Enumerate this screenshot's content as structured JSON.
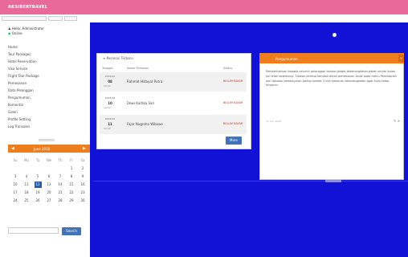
{
  "app": {
    "title": "AKSIBERTRAVEL"
  },
  "filters": [
    {
      "value": ""
    },
    {
      "value": ""
    },
    {
      "value": ""
    }
  ],
  "sidebar": {
    "user_name": "Hello, Administrator",
    "user_role": "Online",
    "items": [
      {
        "label": "Home"
      },
      {
        "label": "Tour Packages"
      },
      {
        "label": "Hotel Reservation"
      },
      {
        "label": "Visa Service"
      },
      {
        "label": "Flight Tour Package"
      },
      {
        "label": "Pemesanan"
      },
      {
        "label": "Data Pelanggan"
      },
      {
        "label": "Pengumuman"
      },
      {
        "label": "Komentar"
      },
      {
        "label": "Galeri"
      },
      {
        "label": "Profile Setting"
      },
      {
        "label": "Log Transaksi"
      }
    ]
  },
  "calendar": {
    "title": "June 2018",
    "prev": "◀",
    "next": "▶",
    "dow": [
      "Su",
      "Mo",
      "Tu",
      "We",
      "Th",
      "Fr",
      "Sa"
    ],
    "weeks": [
      [
        "",
        "",
        "",
        "",
        "",
        "1",
        "2"
      ],
      [
        "3",
        "4",
        "5",
        "6",
        "7",
        "8",
        "9"
      ],
      [
        "10",
        "11",
        "12",
        "13",
        "14",
        "15",
        "16"
      ],
      [
        "17",
        "18",
        "19",
        "20",
        "21",
        "22",
        "23"
      ],
      [
        "24",
        "25",
        "26",
        "27",
        "28",
        "29",
        "30"
      ]
    ],
    "today": "12",
    "search_button": "Search"
  },
  "table": {
    "title": "Pesanan Terbaru",
    "headers": [
      "Tanggal",
      "Nama Pemesan",
      "Status"
    ],
    "rows": [
      {
        "date": "2018-06",
        "day": "08",
        "sub": "10:15",
        "desc": "Rahmat Hidayat Putra",
        "status": "BELUM BAYAR"
      },
      {
        "date": "2018-06",
        "day": "10",
        "sub": "14:02",
        "desc": "Dewi Kartika Sari",
        "status": "BELUM BAYAR"
      },
      {
        "date": "2018-06",
        "day": "11",
        "sub": "09:40",
        "desc": "Fajar Nugroho Wibowo",
        "status": "BELUM BAYAR"
      }
    ],
    "more_button": "More"
  },
  "detail": {
    "title": "Pengumuman",
    "close": "×",
    "body": "Pemberitahuan kepada seluruh pelanggan bahwa jadwal keberangkatan paket umrah bulan Juli telah diperbarui. Silakan periksa kembali detail pemesanan Anda pada menu Pemesanan dan lakukan pembayaran paling lambat 3 hari sebelum keberangkatan agar kursi tetap terjamin.",
    "meta": "12 Juni 2018",
    "actions": "✎ ✕"
  },
  "colors": {
    "accent": "#ee7d1d",
    "topbar": "#e96a9a",
    "background": "#1212d6",
    "button": "#4272b8"
  }
}
